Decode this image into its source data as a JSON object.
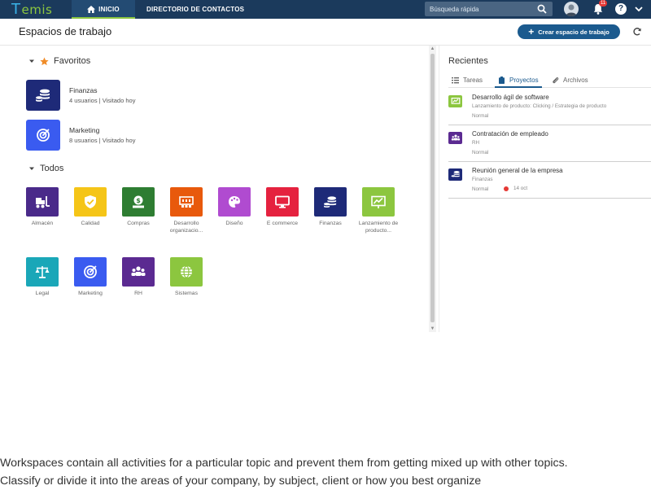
{
  "topbar": {
    "logo_text": "emis",
    "logo_letter": "T",
    "nav": [
      {
        "label": "INICIO"
      },
      {
        "label": "DIRECTORIO DE CONTACTOS"
      }
    ],
    "search_placeholder": "Búsqueda rápida",
    "notifications_count": "11",
    "help_label": "?"
  },
  "header": {
    "title": "Espacios de trabajo",
    "create_label": "Crear espacio de trabajo",
    "create_plus": "+"
  },
  "favorites": {
    "title": "Favoritos",
    "items": [
      {
        "name": "Finanzas",
        "meta": "4 usuarios  |  Visitado hoy",
        "color": "#1e2a78"
      },
      {
        "name": "Marketing",
        "meta": "8 usuarios  |  Visitado hoy",
        "color": "#3a5bf0"
      }
    ]
  },
  "all": {
    "title": "Todos",
    "items": [
      {
        "label": "Almacén",
        "color": "#4a2a8a",
        "icon": "forklift-icon"
      },
      {
        "label": "Calidad",
        "color": "#f5c518",
        "icon": "shield-check-icon"
      },
      {
        "label": "Compras",
        "color": "#2e7d32",
        "icon": "money-icon"
      },
      {
        "label": "Desarrollo organizacio...",
        "color": "#e8590c",
        "icon": "org-chart-icon"
      },
      {
        "label": "Diseño",
        "color": "#b04bd0",
        "icon": "palette-icon"
      },
      {
        "label": "E commerce",
        "color": "#e5223f",
        "icon": "monitor-icon"
      },
      {
        "label": "Finanzas",
        "color": "#1e2a78",
        "icon": "coins-icon"
      },
      {
        "label": "Lanzamiento de producto...",
        "color": "#8cc63f",
        "icon": "presentation-icon"
      },
      {
        "label": "Legal",
        "color": "#1aa7b8",
        "icon": "scale-icon"
      },
      {
        "label": "Marketing",
        "color": "#3a5bf0",
        "icon": "target-icon"
      },
      {
        "label": "RH",
        "color": "#5b2a91",
        "icon": "people-icon"
      },
      {
        "label": "Sistemas",
        "color": "#8cc63f",
        "icon": "globe-icon"
      }
    ]
  },
  "recent": {
    "title": "Recientes",
    "tabs": [
      {
        "label": "Tareas",
        "icon": "list-icon"
      },
      {
        "label": "Proyectos",
        "icon": "clipboard-icon"
      },
      {
        "label": "Archivos",
        "icon": "paperclip-icon"
      }
    ],
    "items": [
      {
        "title": "Desarrollo ágil de software",
        "sub": "Lanzamiento de producto: Clicking / Estrategia de producto",
        "status": "Normal",
        "date": "",
        "color": "#8cc63f"
      },
      {
        "title": "Contratación de empleado",
        "sub": "RH",
        "status": "Normal",
        "date": "",
        "color": "#5b2a91"
      },
      {
        "title": "Reunión general de la empresa",
        "sub": "Finanzas",
        "status": "Normal",
        "date": "14 oct",
        "color": "#1e2a78"
      }
    ]
  },
  "caption": {
    "line1": "Workspaces contain all activities for a particular topic and prevent them from getting mixed up with other topics.",
    "line2": "Classify or divide it into the areas of your company, by subject, client or how you best organize"
  }
}
